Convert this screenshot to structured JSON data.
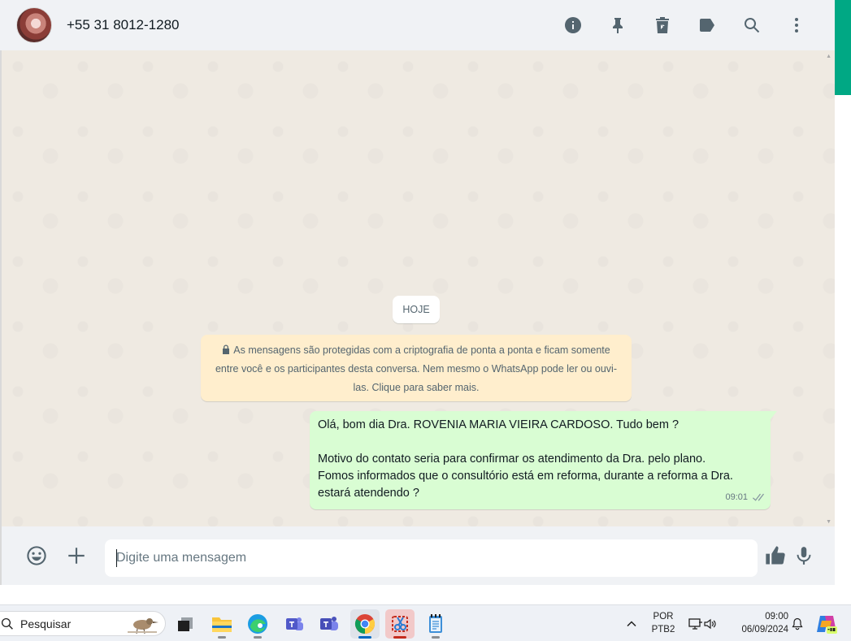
{
  "header": {
    "contact_name": "+55 31 8012-1280",
    "actions": [
      "info-icon",
      "pin-icon",
      "delete-icon",
      "label-icon",
      "search-icon",
      "menu-icon"
    ]
  },
  "chat": {
    "date_chip": "HOJE",
    "system_message": "As mensagens são protegidas com a criptografia de ponta a ponta e ficam somente entre você e os participantes desta conversa. Nem mesmo o WhatsApp pode ler ou ouvi-las. Clique para saber mais.",
    "messages": [
      {
        "direction": "outgoing",
        "lines": [
          "Olá, bom dia Dra.  ROVENIA MARIA VIEIRA CARDOSO. Tudo bem ?",
          "",
          "Motivo do contato seria para confirmar os atendimento da Dra. pelo plano.",
          "Fomos informados que o consultório está em reforma, durante a reforma a Dra.",
          "estará atendendo ?"
        ],
        "time": "09:01",
        "status": "double-check-icon"
      }
    ]
  },
  "composer": {
    "placeholder": "Digite uma mensagem",
    "value": ""
  },
  "taskbar": {
    "search_placeholder": "Pesquisar",
    "apps": [
      "task-view",
      "file-explorer",
      "edge",
      "teams-classic",
      "teams",
      "chrome",
      "snipping-tool",
      "notepad"
    ],
    "tray": {
      "language_line1": "POR",
      "language_line2": "PTB2",
      "time": "09:00",
      "date": "06/09/2024"
    }
  },
  "colors": {
    "accent": "#00a884",
    "outgoing_bubble": "#d9fdd3",
    "system_bubble": "#ffeecd",
    "chat_background": "#efeae2",
    "header_background": "#f0f2f5"
  }
}
